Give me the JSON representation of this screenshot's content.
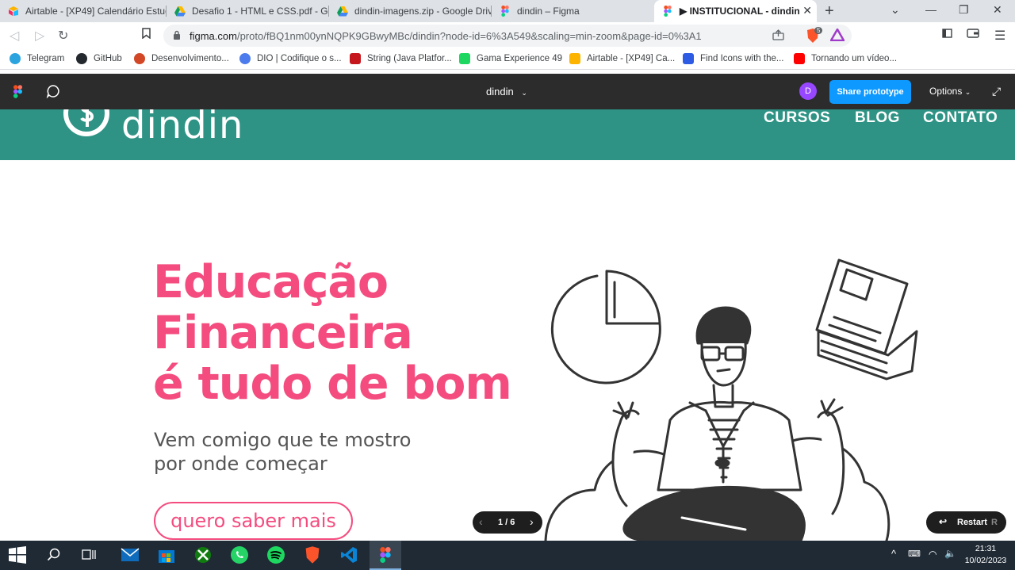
{
  "tabs": [
    {
      "label": "Airtable - [XP49] Calendário Estudo",
      "icon": "airtable-icon"
    },
    {
      "label": "Desafio 1 - HTML e CSS.pdf - Goo",
      "icon": "drive-icon"
    },
    {
      "label": "dindin-imagens.zip - Google Drive",
      "icon": "drive-icon"
    },
    {
      "label": "dindin – Figma",
      "icon": "figma-icon"
    },
    {
      "label": "▶ INSTITUCIONAL - dindin",
      "icon": "figma-icon"
    }
  ],
  "address": {
    "host": "figma.com",
    "path": "/proto/fBQ1nm00ynNQPK9GBwyMBc/dindin?node-id=6%3A549&scaling=min-zoom&page-id=0%3A1",
    "extension_badge": "5"
  },
  "bookmarks": [
    {
      "label": "Telegram",
      "color": "#2aa3df"
    },
    {
      "label": "GitHub",
      "color": "#24292f"
    },
    {
      "label": "Desenvolvimento...",
      "color": "#d24726"
    },
    {
      "label": "DIO | Codifique o s...",
      "color": "#4b7bec"
    },
    {
      "label": "String (Java Platfor...",
      "color": "#c5161d"
    },
    {
      "label": "Gama Experience 49",
      "color": "#1ed760"
    },
    {
      "label": "Airtable - [XP49] Ca...",
      "color": "#fcb400"
    },
    {
      "label": "Find Icons with the...",
      "color": "#2d5be3"
    },
    {
      "label": "Tornando um vídeo...",
      "color": "#ff0000"
    }
  ],
  "figma": {
    "file_name": "dindin",
    "avatar": "D",
    "share_label": "Share prototype",
    "options_label": "Options"
  },
  "site": {
    "brand": "dindin",
    "nav": [
      "CURSOS",
      "BLOG",
      "CONTATO"
    ],
    "hero_title": [
      "Educação",
      "Financeira",
      "é tudo de bom"
    ],
    "hero_subtitle": [
      "Vem comigo que te mostro",
      "por onde começar"
    ],
    "cta_label": "quero saber mais",
    "colors": {
      "header": "#2e9385",
      "accent": "#f44c7f",
      "text": "#555555"
    }
  },
  "prototype": {
    "pager": "1 / 6",
    "restart_label": "Restart",
    "restart_key": "R"
  },
  "taskbar": {
    "time": "21:31",
    "date": "10/02/2023"
  }
}
